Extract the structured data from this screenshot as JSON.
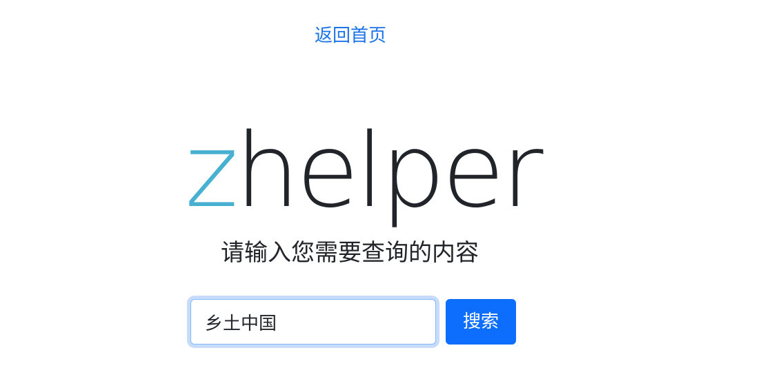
{
  "nav": {
    "home_link": "返回首页"
  },
  "brand": {
    "logo_first_letter": "z",
    "logo_rest": "helper",
    "accent_color": "#48b0d1",
    "text_color": "#212529"
  },
  "main": {
    "subtitle": "请输入您需要查询的内容"
  },
  "search": {
    "value": "乡土中国",
    "placeholder": "",
    "button_label": "搜索",
    "button_color": "#0d6efd"
  },
  "link_color": "#1a73e8"
}
